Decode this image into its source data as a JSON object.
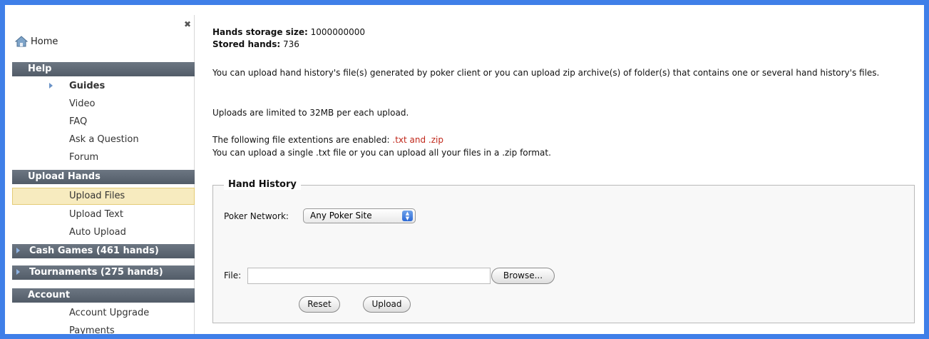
{
  "sidebar": {
    "home_label": "Home",
    "sections": {
      "help": "Help",
      "upload_hands": "Upload Hands",
      "cash_games": "Cash Games (461 hands)",
      "tournaments": "Tournaments (275 hands)",
      "account": "Account"
    },
    "help_items": [
      "Guides",
      "Video",
      "FAQ",
      "Ask a Question",
      "Forum"
    ],
    "upload_items": [
      "Upload Files",
      "Upload Text",
      "Auto Upload"
    ],
    "account_items": [
      "Account Upgrade",
      "Payments"
    ]
  },
  "main": {
    "storage_label": "Hands storage size:",
    "storage_value": "1000000000",
    "stored_label": "Stored hands:",
    "stored_value": "736",
    "intro": "You can upload hand history's file(s) generated by poker client or you can upload zip archive(s) of folder(s) that contains one or several hand history's files.",
    "limit": "Uploads are limited to 32MB per each upload.",
    "ext_prefix": "The following file extentions are enabled: ",
    "ext_value": ".txt and .zip",
    "single_note": "You can upload a single .txt file or you can upload all your files in a .zip format."
  },
  "form": {
    "legend": "Hand History",
    "network_label": "Poker Network:",
    "network_value": "Any Poker Site",
    "file_label": "File:",
    "file_value": "",
    "browse_label": "Browse...",
    "reset_label": "Reset",
    "upload_label": "Upload"
  },
  "colors": {
    "frame_border": "#3f7fe8",
    "section_header": "#5c6672",
    "active_item": "#f7ebbf",
    "extension_text": "#c0271a"
  }
}
